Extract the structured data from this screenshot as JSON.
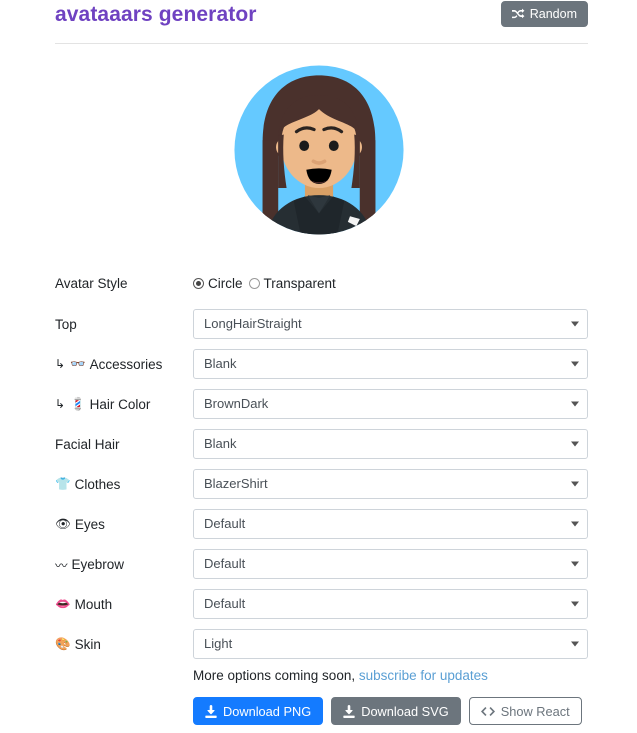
{
  "header": {
    "title": "avataaars generator",
    "title_color": "#6f42c1",
    "random_label": "Random",
    "random_icon": "shuffle-icon"
  },
  "avatar": {
    "background_color": "#65C9FF",
    "skin_color": "#EDB98A",
    "hair_color": "#4A312C",
    "clothes_color": "#262E33",
    "mouth_color": "#000000",
    "eye_color": "#000000",
    "style": "Circle",
    "top": "LongHairStraight",
    "clothes": "BlazerShirt"
  },
  "form": {
    "style_row": {
      "label": "Avatar Style",
      "options": [
        {
          "label": "Circle",
          "selected": true
        },
        {
          "label": "Transparent",
          "selected": false
        }
      ]
    },
    "rows": [
      {
        "label": "Top",
        "icon": "",
        "sub": false,
        "value": "LongHairStraight"
      },
      {
        "label": "Accessories",
        "icon": "👓",
        "sub": true,
        "value": "Blank"
      },
      {
        "label": "Hair Color",
        "icon": "💈",
        "sub": true,
        "value": "BrownDark"
      },
      {
        "label": "Facial Hair",
        "icon": "",
        "sub": false,
        "value": "Blank"
      },
      {
        "label": "Clothes",
        "icon": "👕",
        "sub": false,
        "value": "BlazerShirt"
      },
      {
        "label": "Eyes",
        "icon": "👁",
        "sub": false,
        "value": "Default"
      },
      {
        "label": "Eyebrow",
        "icon": "〰",
        "sub": false,
        "value": "Default"
      },
      {
        "label": "Mouth",
        "icon": "👄",
        "sub": false,
        "value": "Default"
      },
      {
        "label": "Skin",
        "icon": "🎨",
        "sub": false,
        "value": "Light"
      }
    ],
    "sub_arrow": "↳"
  },
  "footer": {
    "more_text_prefix": "More options coming soon, ",
    "subscribe_link": "subscribe for updates",
    "buttons": [
      {
        "label": "Download PNG",
        "icon": "download-icon",
        "variant": "primary"
      },
      {
        "label": "Download SVG",
        "icon": "download-icon",
        "variant": "secondary"
      },
      {
        "label": "Show React",
        "icon": "code-icon",
        "variant": "outline"
      }
    ]
  }
}
